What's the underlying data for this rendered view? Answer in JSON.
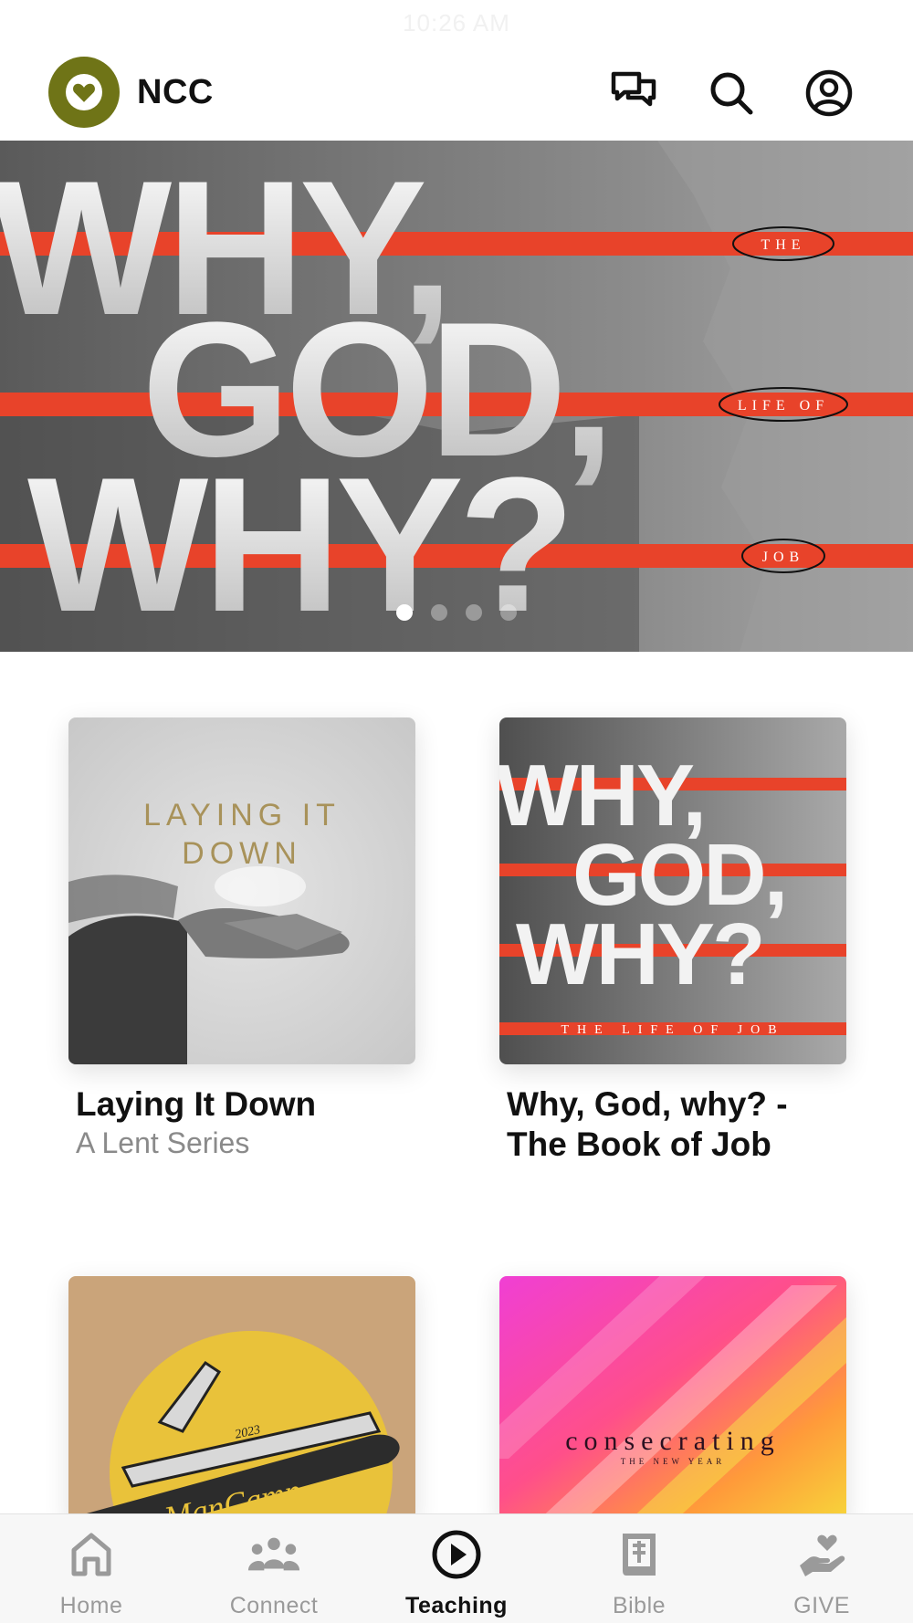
{
  "status_bar": {
    "time": "10:26 AM"
  },
  "header": {
    "app_name": "NCC",
    "icons": [
      "heart-logo-icon",
      "chat-icon",
      "search-icon",
      "profile-icon"
    ]
  },
  "hero": {
    "artwork_text": [
      "WHY,",
      "GOD,",
      "WHY?"
    ],
    "side_labels": [
      "THE",
      "LIFE OF",
      "JOB"
    ],
    "carousel_dots": 4,
    "active_dot": 1
  },
  "cards": [
    {
      "title": "Laying It Down",
      "subtitle": "A Lent Series",
      "art_text": [
        "LAYING IT",
        "DOWN"
      ]
    },
    {
      "title": "Why, God, why? - The Book of Job",
      "subtitle": "",
      "art_text": [
        "WHY,",
        "GOD,",
        "WHY?",
        "THE LIFE OF JOB"
      ]
    },
    {
      "title": "",
      "subtitle": "",
      "art_text": [
        "ManCamp",
        "2023"
      ]
    },
    {
      "title": "",
      "subtitle": "",
      "art_text": [
        "consecrating",
        "THE NEW YEAR"
      ]
    }
  ],
  "tabbar": {
    "tabs": [
      {
        "label": "Home",
        "icon": "home-icon",
        "active": false
      },
      {
        "label": "Connect",
        "icon": "people-icon",
        "active": false
      },
      {
        "label": "Teaching",
        "icon": "play-circle-icon",
        "active": true
      },
      {
        "label": "Bible",
        "icon": "book-icon",
        "active": false
      },
      {
        "label": "GIVE",
        "icon": "give-hand-heart-icon",
        "active": false
      }
    ]
  },
  "colors": {
    "brand": "#6f7417",
    "stripe_red": "#e8432a",
    "active_tab": "#111111",
    "inactive_tab": "#9a9a9a"
  }
}
